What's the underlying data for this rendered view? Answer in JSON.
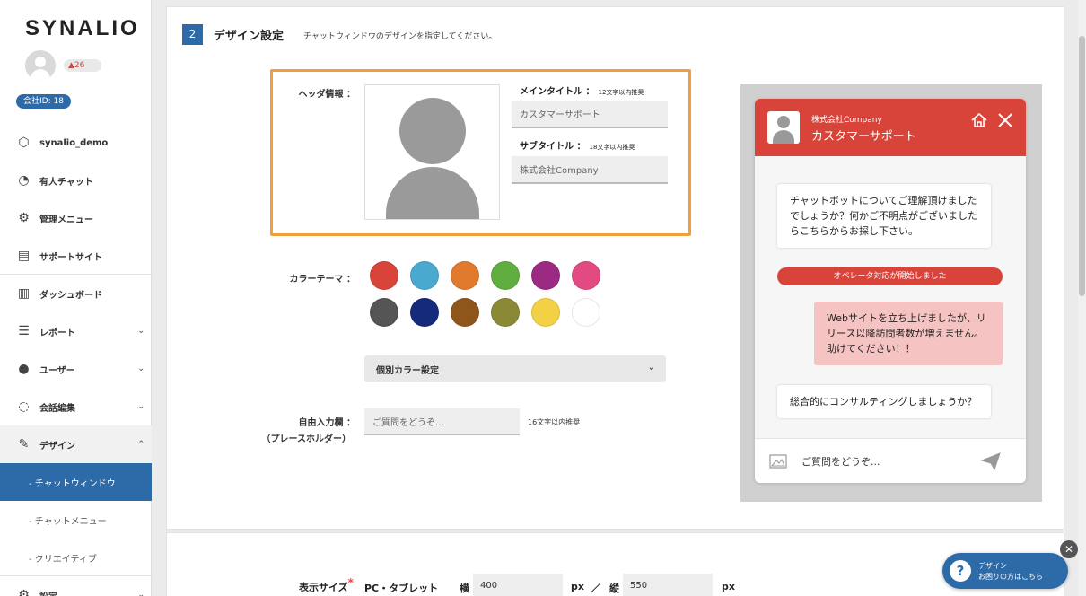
{
  "sidebar": {
    "logo": "SYNALIO",
    "notifications": "26",
    "company_id": "会社ID: 18",
    "items": [
      {
        "label": "synalio_demo",
        "icon": "cube-icon"
      },
      {
        "label": "有人チャット",
        "icon": "headset-icon"
      },
      {
        "label": "管理メニュー",
        "icon": "gears-icon"
      },
      {
        "label": "サポートサイト",
        "icon": "window-icon"
      },
      {
        "label": "ダッシュボード",
        "icon": "bar-chart-icon"
      },
      {
        "label": "レポート",
        "icon": "list-icon"
      },
      {
        "label": "ユーザー",
        "icon": "users-icon"
      },
      {
        "label": "会話編集",
        "icon": "chat-icon"
      },
      {
        "label": "デザイン",
        "icon": "edit-icon"
      },
      {
        "label": "- チャットウィンドウ"
      },
      {
        "label": "- チャットメニュー"
      },
      {
        "label": "- クリエイティブ"
      },
      {
        "label": "設定",
        "icon": "settings-icon"
      }
    ]
  },
  "section": {
    "step": "2",
    "title": "デザイン設定",
    "description": "チャットウィンドウのデザインを指定してください。"
  },
  "header_info": {
    "label": "ヘッダ情報 ：",
    "main_title_label": "メインタイトル ：",
    "main_title_hint": "12文字以内推奨",
    "main_title_value": "カスタマーサポート",
    "sub_title_label": "サブタイトル ：",
    "sub_title_hint": "18文字以内推奨",
    "sub_title_value": "株式会社Company"
  },
  "color_theme": {
    "label": "カラーテーマ ：",
    "colors": [
      "#d9443a",
      "#4aa9cf",
      "#e07b2e",
      "#5fae3f",
      "#9c2a82",
      "#e34a82",
      "#555555",
      "#142a7a",
      "#8e561b",
      "#8a8a36",
      "#f3d144",
      "#ffffff"
    ],
    "custom_label": "個別カラー設定"
  },
  "free_input": {
    "label": "自由入力欄 ：",
    "label2": "（プレースホルダー）",
    "placeholder": "ご質問をどうぞ...",
    "hint": "16文字以内推奨"
  },
  "preview": {
    "company": "株式会社Company",
    "title": "カスタマーサポート",
    "bot_message_1": "チャットボットについてご理解頂けましたでしょうか？何かご不明点がございましたらこちらからお探し下さい。",
    "operator_notice": "オペレータ対応が開始しました",
    "user_message": "Webサイトを立ち上げましたが、リリース以降訪問者数が増えません。助けてください！！",
    "bot_message_2": "総合的にコンサルティングしましょうか？",
    "input_placeholder": "ご質問をどうぞ..."
  },
  "display_size": {
    "label": "表示サイズ",
    "device": "PC・タブレット",
    "width_label": "横",
    "width": "400",
    "unit": "px",
    "separator": "／",
    "height_label": "縦",
    "height": "550"
  },
  "help": {
    "line1": "デザイン",
    "line2": "お困りの方はこちら"
  }
}
